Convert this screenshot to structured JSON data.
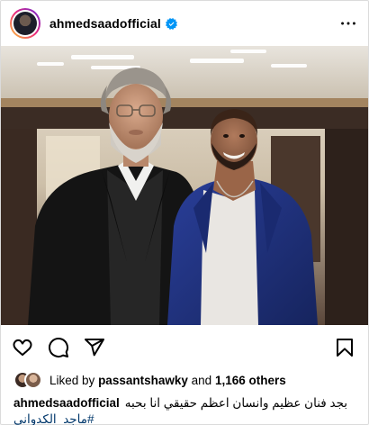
{
  "header": {
    "username": "ahmedsaadofficial",
    "verified": true,
    "more_icon": "more-horizontal-icon"
  },
  "photo": {
    "description_icon": "post-photo"
  },
  "actions": {
    "icons": [
      "heart-icon",
      "comment-icon",
      "share-icon",
      "bookmark-icon"
    ]
  },
  "likes": {
    "prefix": "Liked by",
    "user": "passantshawky",
    "middle": "and",
    "others": "1,166 others"
  },
  "caption": {
    "username": "ahmedsaadofficial",
    "text": "بجد فنان عظيم وانسان اعظم حقيقي انا بحبه",
    "hashtag": "#ماجد_الكدواني"
  },
  "colors": {
    "accent_link": "#00376b",
    "verified_blue": "#0095f6",
    "border": "#dbdbdb"
  }
}
